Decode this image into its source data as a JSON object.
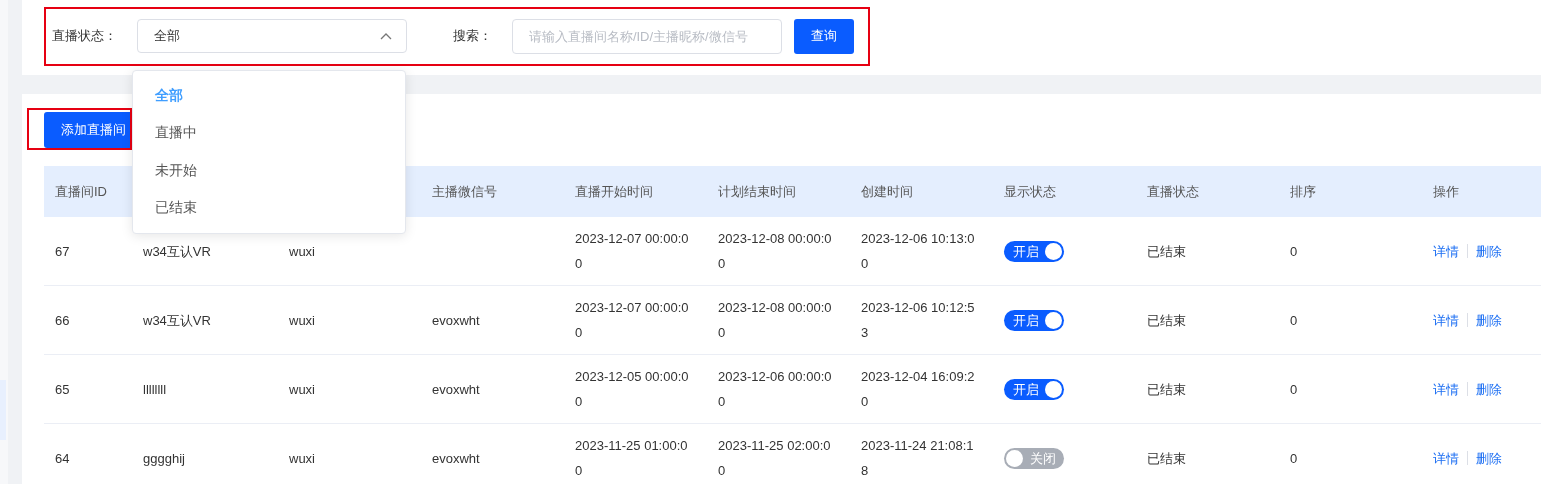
{
  "filters": {
    "highlighted": true,
    "status_label": "直播状态：",
    "status_value": "全部",
    "expanded": true,
    "options": [
      {
        "label": "全部",
        "selected": true
      },
      {
        "label": "直播中",
        "selected": false
      },
      {
        "label": "未开始",
        "selected": false
      },
      {
        "label": "已结束",
        "selected": false
      }
    ],
    "search_label": "搜索：",
    "search_placeholder": "请输入直播间名称/ID/主播昵称/微信号",
    "query_button": "查询"
  },
  "add_button": {
    "label": "添加直播间",
    "highlighted": true
  },
  "table": {
    "columns": [
      {
        "label": "直播间ID"
      },
      {},
      {},
      {
        "label": "主播微信号"
      },
      {
        "label": "直播开始时间"
      },
      {
        "label": "计划结束时间"
      },
      {
        "label": "创建时间"
      },
      {
        "label": "显示状态"
      },
      {
        "label": "直播状态"
      },
      {
        "label": "排序"
      },
      {
        "label": "操作"
      }
    ],
    "rows": [
      {
        "id": "67",
        "name": "w34互认VR",
        "anchor": "wuxi",
        "start": "2023-12-07 00:00:00",
        "end": "2023-12-08 00:00:00",
        "created": "2023-12-06 10:13:00",
        "display": {
          "on": true,
          "label": "开启"
        },
        "status": "已结束",
        "sort": "0",
        "actions": [
          "详情",
          "删除"
        ]
      },
      {
        "id": "66",
        "name": "w34互认VR",
        "anchor": "wuxi",
        "wechat": "evoxwht",
        "start": "2023-12-07 00:00:00",
        "end": "2023-12-08 00:00:00",
        "created": "2023-12-06 10:12:53",
        "display": {
          "on": true,
          "label": "开启"
        },
        "status": "已结束",
        "sort": "0",
        "actions": [
          "详情",
          "删除"
        ]
      },
      {
        "id": "65",
        "name": "llllllll",
        "anchor": "wuxi",
        "wechat": "evoxwht",
        "start": "2023-12-05 00:00:00",
        "end": "2023-12-06 00:00:00",
        "created": "2023-12-04 16:09:20",
        "display": {
          "on": true,
          "label": "开启"
        },
        "status": "已结束",
        "sort": "0",
        "actions": [
          "详情",
          "删除"
        ]
      },
      {
        "id": "64",
        "name": "gggghij",
        "anchor": "wuxi",
        "wechat": "evoxwht",
        "start": "2023-11-25 01:00:00",
        "end": "2023-11-25 02:00:00",
        "created": "2023-11-24 21:08:18",
        "display": {
          "on": false,
          "label": "关闭"
        },
        "status": "已结束",
        "sort": "0",
        "actions": [
          "详情",
          "删除"
        ]
      }
    ]
  }
}
